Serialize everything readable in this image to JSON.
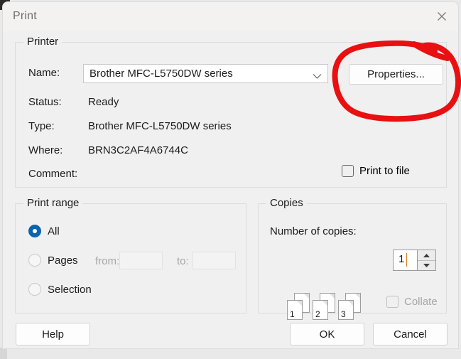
{
  "window": {
    "title": "Print",
    "close_icon": "close-icon"
  },
  "printer": {
    "group_label": "Printer",
    "name_label": "Name:",
    "name_value": "Brother MFC-L5750DW series",
    "name_dropdown_icon": "chevron-down-icon",
    "properties_button": "Properties...",
    "status_label": "Status:",
    "status_value": "Ready",
    "type_label": "Type:",
    "type_value": "Brother MFC-L5750DW series",
    "where_label": "Where:",
    "where_value": "BRN3C2AF4A6744C",
    "comment_label": "Comment:",
    "comment_value": "",
    "print_to_file_label": "Print to file",
    "print_to_file_checked": false
  },
  "print_range": {
    "group_label": "Print range",
    "all_label": "All",
    "pages_label": "Pages",
    "from_label": "from:",
    "from_value": "",
    "to_label": "to:",
    "to_value": "",
    "selection_label": "Selection",
    "selected": "All"
  },
  "copies": {
    "group_label": "Copies",
    "number_label": "Number of copies:",
    "number_value": "1",
    "spin_up_icon": "triangle-up-icon",
    "spin_down_icon": "triangle-down-icon",
    "collate_label": "Collate",
    "collate_checked": false,
    "collate_pages": [
      {
        "front": "1",
        "back": "1"
      },
      {
        "front": "2",
        "back": "2"
      },
      {
        "front": "3",
        "back": "3"
      }
    ]
  },
  "footer": {
    "help_button": "Help",
    "ok_button": "OK",
    "cancel_button": "Cancel"
  },
  "annotation": {
    "type": "hand-drawn-red-ellipse",
    "target": "Properties... button",
    "color": "#e81010"
  },
  "colors": {
    "accent": "#0a64ad",
    "dialog_bg": "#f0f0f0",
    "titlebar_bg": "#f3f2f1",
    "annotation_red": "#e81010",
    "caret_orange": "#e07b20"
  }
}
